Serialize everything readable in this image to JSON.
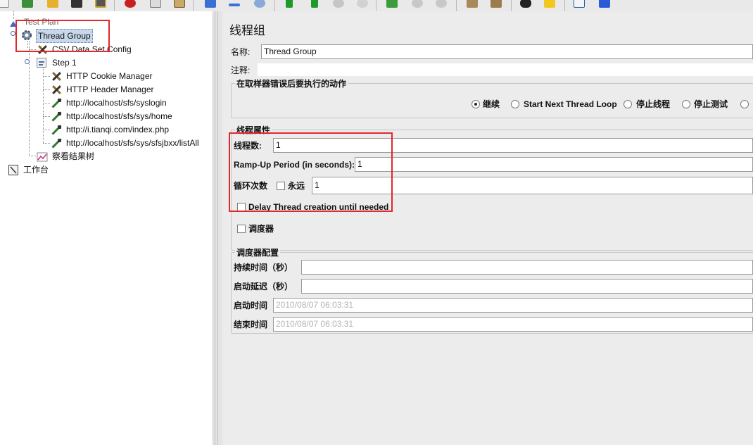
{
  "toolbar": {
    "icons": [
      "new-icon",
      "templates-icon",
      "open-icon",
      "save-icon",
      "save-as-icon",
      "cut-icon",
      "copy-icon",
      "paste-icon",
      "expand-icon",
      "collapse-icon",
      "toggle-icon",
      "start-icon",
      "start-no-pause-icon",
      "stop-icon",
      "shutdown-icon",
      "remote-start-icon",
      "remote-stop-icon",
      "remote-exit-icon",
      "clear-icon",
      "clear-all-icon",
      "search-icon",
      "reset-search-icon",
      "function-helper-icon",
      "help-icon"
    ]
  },
  "tree": {
    "test_plan": "Test Plan",
    "thread_group": "Thread Group",
    "csv_config": "CSV Data Set Config",
    "step1": "Step 1",
    "cookie_manager": "HTTP Cookie Manager",
    "header_manager": "HTTP Header Manager",
    "sampler1": "http://localhost/sfs/syslogin",
    "sampler2": "http://localhost/sfs/sys/home",
    "sampler3": "http://i.tianqi.com/index.php",
    "sampler4": "http://localhost/sfs/sys/sfsjbxx/listAll",
    "result_tree": "察看结果树",
    "workbench": "工作台"
  },
  "panel": {
    "title": "线程组",
    "name_label": "名称:",
    "name_value": "Thread Group",
    "comment_label": "注释:",
    "comment_value": "",
    "error_group_title": "在取样器错误后要执行的动作",
    "error_actions": {
      "continue": "继续",
      "next_loop": "Start Next Thread Loop",
      "stop_thread": "停止线程",
      "stop_test": "停止测试"
    },
    "thread_props_title": "线程属性",
    "threads_label": "线程数:",
    "threads_value": "1",
    "rampup_label": "Ramp-Up Period (in seconds):",
    "rampup_value": "1",
    "loop_label": "循环次数",
    "forever_label": "永远",
    "loop_value": "1",
    "delay_label": "Delay Thread creation until needed",
    "scheduler_label": "调度器",
    "scheduler_group_title": "调度器配置",
    "duration_label": "持续时间（秒）",
    "duration_value": "",
    "delay_start_label": "启动延迟（秒）",
    "delay_start_value": "",
    "start_time_label": "启动时间",
    "start_time_value": "2010/08/07 06:03:31",
    "end_time_label": "结束时间",
    "end_time_value": "2010/08/07 06:03:31"
  },
  "colors": {
    "highlight": "#e0282d",
    "selection": "#c8d8ec"
  }
}
